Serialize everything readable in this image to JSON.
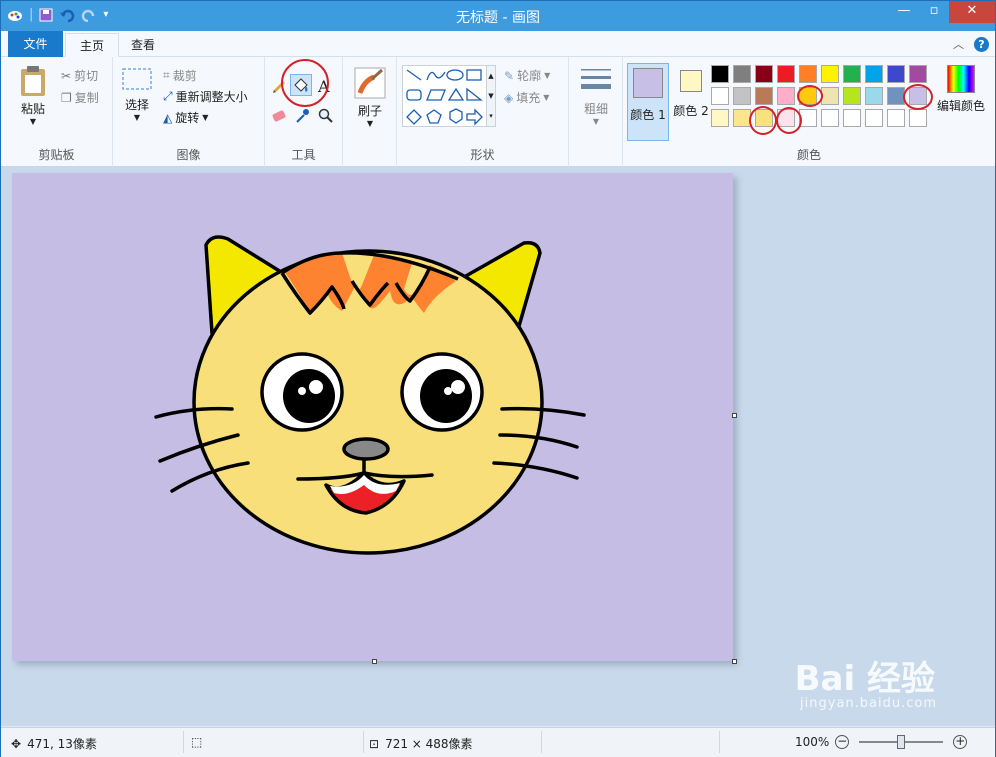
{
  "window": {
    "title": "无标题 - 画图"
  },
  "tabs": {
    "file": "文件",
    "home": "主页",
    "view": "查看"
  },
  "clipboard": {
    "paste": "粘贴",
    "cut": "剪切",
    "copy": "复制",
    "label": "剪贴板"
  },
  "image": {
    "select": "选择",
    "crop": "裁剪",
    "resize": "重新调整大小",
    "rotate": "旋转",
    "label": "图像"
  },
  "tools": {
    "label": "工具"
  },
  "brushes": {
    "label": "刷子"
  },
  "shapes": {
    "outline": "轮廓",
    "fill": "填充",
    "label": "形状"
  },
  "size": {
    "label": "粗细"
  },
  "colors": {
    "color1_label": "颜色 1",
    "color2_label": "颜色 2",
    "edit_label": "编辑颜色",
    "label": "颜色",
    "color1": "#c8bfe7",
    "color2": "#fff8c4",
    "palette_row1": [
      "#000000",
      "#7f7f7f",
      "#880015",
      "#ed1c24",
      "#ff7f27",
      "#fff200",
      "#22b14c",
      "#00a2e8",
      "#3f48cc",
      "#a349a4"
    ],
    "palette_row2": [
      "#ffffff",
      "#c3c3c3",
      "#b97a57",
      "#ffaec9",
      "#ffc90e",
      "#efe4b0",
      "#b5e61d",
      "#99d9ea",
      "#7092be",
      "#c8bfe7"
    ],
    "palette_row3": [
      "#fff8c4",
      "#fde58e",
      "#f9e17e",
      "#fde2ec",
      "#ffffff",
      "#ffffff",
      "#ffffff",
      "#ffffff",
      "#ffffff",
      "#ffffff"
    ]
  },
  "canvas": {
    "background": "#c5bde4"
  },
  "status": {
    "cursor_pos": "471, 13像素",
    "canvas_size": "721 × 488像素",
    "zoom": "100%"
  },
  "watermark": {
    "brand": "Bai 经验",
    "url": "jingyan.baidu.com"
  }
}
